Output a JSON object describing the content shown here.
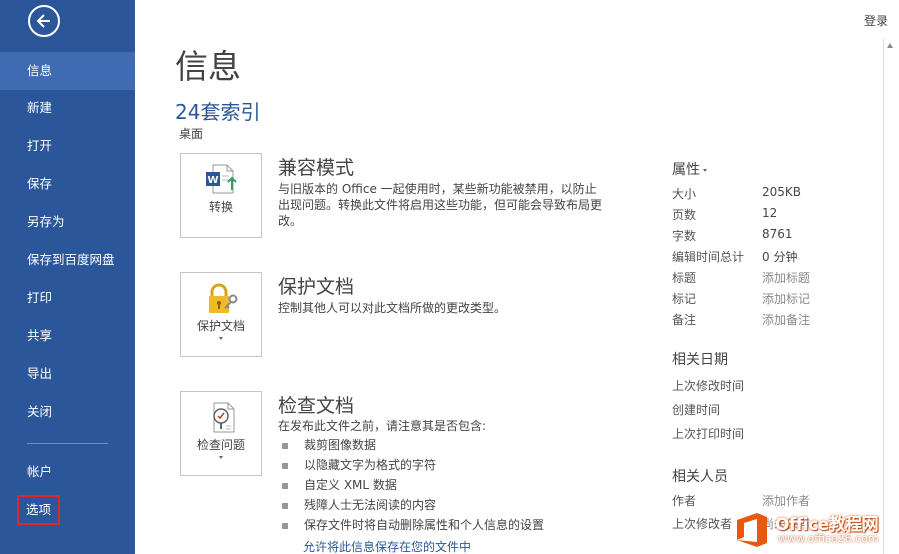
{
  "nav": {
    "items": [
      "信息",
      "新建",
      "打开",
      "保存",
      "另存为",
      "保存到百度网盘",
      "打印",
      "共享",
      "导出",
      "关闭",
      "帐户",
      "选项"
    ]
  },
  "header": {
    "login": "登录"
  },
  "page": {
    "title": "信息",
    "doc_name": "24套索引",
    "location": "桌面"
  },
  "sections": {
    "compat": {
      "button": "转换",
      "title": "兼容模式",
      "desc": "与旧版本的 Office 一起使用时，某些新功能被禁用，以防止出现问题。转换此文件将启用这些功能，但可能会导致布局更改。"
    },
    "protect": {
      "button": "保护文档",
      "title": "保护文档",
      "desc": "控制其他人可以对此文档所做的更改类型。"
    },
    "inspect": {
      "button": "检查问题",
      "title": "检查文档",
      "desc": "在发布此文件之前，请注意其是否包含:",
      "bullets": [
        "裁剪图像数据",
        "以隐藏文字为格式的字符",
        "自定义 XML 数据",
        "残障人士无法阅读的内容",
        "保存文件时将自动删除属性和个人信息的设置"
      ],
      "link": "允许将此信息保存在您的文件中"
    }
  },
  "properties": {
    "title": "属性",
    "rows": [
      {
        "k": "大小",
        "v": "205KB"
      },
      {
        "k": "页数",
        "v": "12"
      },
      {
        "k": "字数",
        "v": "8761"
      },
      {
        "k": "编辑时间总计",
        "v": "0 分钟"
      },
      {
        "k": "标题",
        "v": "添加标题"
      },
      {
        "k": "标记",
        "v": "添加标记"
      },
      {
        "k": "备注",
        "v": "添加备注"
      }
    ]
  },
  "dates": {
    "title": "相关日期",
    "rows": [
      "上次修改时间",
      "创建时间",
      "上次打印时间"
    ]
  },
  "people": {
    "title": "相关人员",
    "author_label": "作者",
    "author_value": "添加作者",
    "modifier_label": "上次修改者",
    "modifier_value": "尚未保存"
  },
  "watermark": {
    "brand": "Office教程网",
    "url": "www.office26.com"
  },
  "colors": {
    "sidebar": "#2b579a",
    "sidebar_active": "#3f6bb3",
    "highlight_box": "#e0262b",
    "accent": "#2b579a",
    "watermark_orange": "#e8590c"
  },
  "icons": [
    "back-arrow-icon",
    "word-convert-icon",
    "lock-key-icon",
    "inspect-document-icon",
    "office-logo-icon"
  ]
}
